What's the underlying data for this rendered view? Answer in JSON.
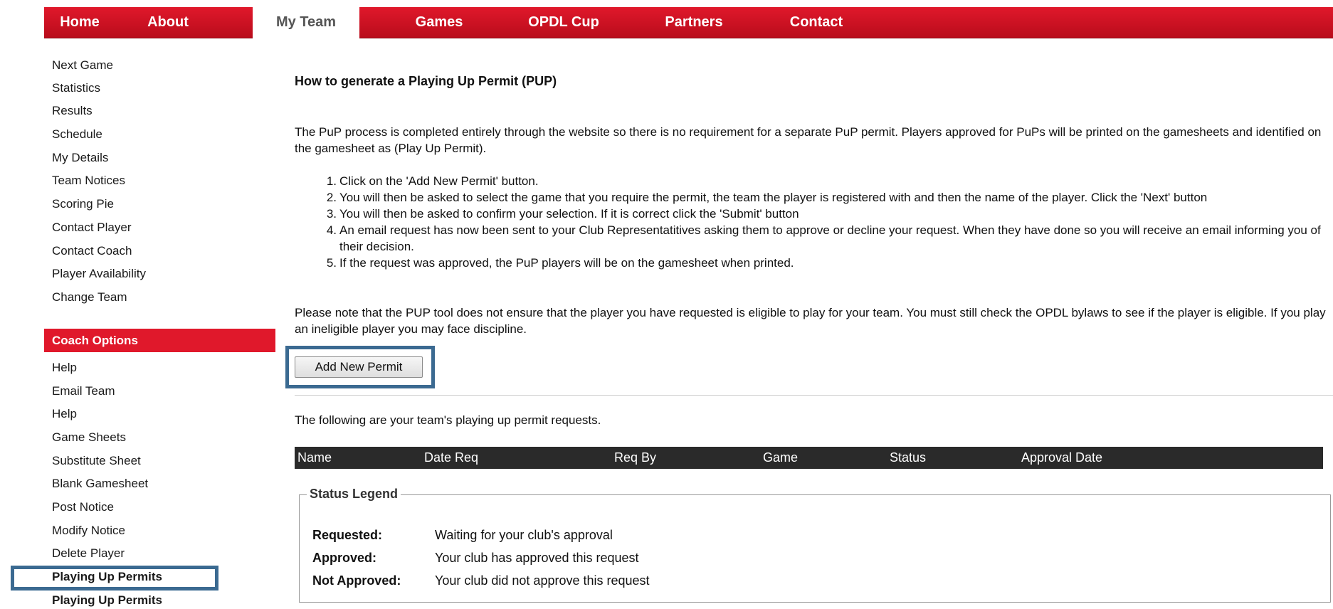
{
  "nav": {
    "items": [
      {
        "label": "Home"
      },
      {
        "label": "About"
      },
      {
        "label": "My Team"
      },
      {
        "label": "Games"
      },
      {
        "label": "OPDL Cup"
      },
      {
        "label": "Partners"
      },
      {
        "label": "Contact"
      }
    ],
    "active": "My Team"
  },
  "sidebar": {
    "team_links": [
      "Next Game",
      "Statistics",
      "Results",
      "Schedule",
      "My Details",
      "Team Notices",
      "Scoring Pie",
      "Contact Player",
      "Contact Coach",
      "Player Availability",
      "Change Team"
    ],
    "coach_header": "Coach Options",
    "coach_links": [
      "Help",
      "Email Team",
      "Help",
      "Game Sheets",
      "Substitute Sheet",
      "Blank Gamesheet",
      "Post Notice",
      "Modify Notice",
      "Delete Player",
      "Playing Up Permits",
      "Playing Up Permits"
    ]
  },
  "main": {
    "title": "How to generate a Playing Up Permit (PUP)",
    "intro": "The PuP process is completed entirely through the website so there is no requirement for a separate PuP permit. Players approved for PuPs will be printed on the gamesheets and identified on the gamesheet as (Play Up Permit).",
    "steps": [
      {
        "num": "1.",
        "text": "Click on the 'Add New Permit' button."
      },
      {
        "num": "2.",
        "text": "You will then be asked to select the game that you require the permit, the team the player is registered with and then the name of the player. Click the 'Next' button"
      },
      {
        "num": "3.",
        "text": "You will then be asked to confirm your selection. If it is correct click the 'Submit' button"
      },
      {
        "num": "4.",
        "text": "An email request has now been sent to your Club Representatitives asking them to approve or decline your request. When they have done so you will receive an email informing you of their decision."
      },
      {
        "num": "5.",
        "text": "If the request was approved, the PuP players will be on the gamesheet when printed."
      }
    ],
    "note": "Please note that the PUP tool does not ensure that the player you have requested is eligible to play for your team. You must still check the OPDL bylaws to see if the player is eligible. If you play an ineligible player you may face discipline.",
    "add_button": "Add New Permit",
    "requests_intro": "The following are your team's playing up permit requests.",
    "table_headers": [
      "Name",
      "Date Req",
      "Req By",
      "Game",
      "Status",
      "Approval Date"
    ],
    "legend": {
      "title": "Status Legend",
      "rows": [
        {
          "label": "Requested:",
          "desc": "Waiting for your club's approval"
        },
        {
          "label": "Approved:",
          "desc": "Your club has approved this request"
        },
        {
          "label": "Not Approved:",
          "desc": "Your club did not approve this request"
        }
      ]
    }
  },
  "colors": {
    "nav_red": "#e0182b",
    "highlight_blue": "#3b6a91",
    "table_header": "#2a2a2a"
  }
}
